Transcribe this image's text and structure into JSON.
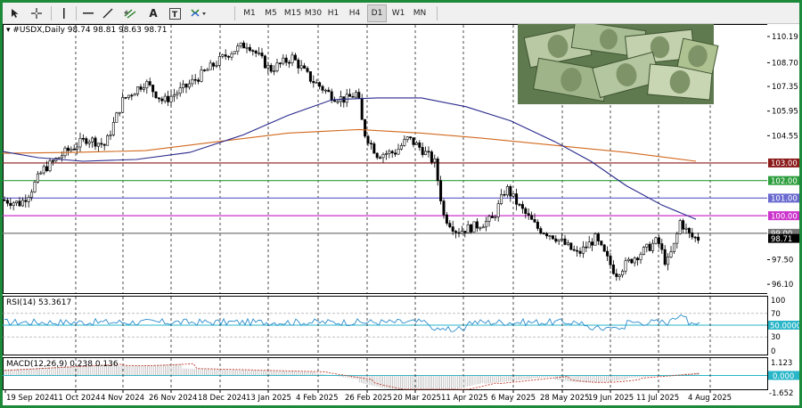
{
  "toolbar": {
    "timeframes": [
      "M1",
      "M5",
      "M15",
      "M30",
      "H1",
      "H4",
      "D1",
      "W1",
      "MN"
    ],
    "active_timeframe": "D1",
    "tools": [
      "cursor-icon",
      "crosshair-icon",
      "vertical-line-icon",
      "horizontal-line-icon",
      "trendline-icon",
      "channel-icon",
      "text-icon",
      "label-icon",
      "shapes-icon"
    ]
  },
  "chart": {
    "header": "#USDX,Daily  98.74 98.81 98.63 98.71",
    "price_scale": [
      "110.19",
      "108.70",
      "107.35",
      "105.95",
      "104.55",
      "103.00",
      "102.00",
      "101.00",
      "100.00",
      "99.00",
      "98.71",
      "97.50",
      "96.10"
    ],
    "hlines": [
      {
        "price": 103.0,
        "color": "#8b1a1a",
        "label": "103.00"
      },
      {
        "price": 102.0,
        "color": "#2e9e3e",
        "label": "102.00"
      },
      {
        "price": 101.0,
        "color": "#6a6ad0",
        "label": "101.00"
      },
      {
        "price": 100.0,
        "color": "#cc33cc",
        "label": "100.00"
      },
      {
        "price": 99.0,
        "color": "#777777",
        "label": "99.00"
      }
    ],
    "current_price": "98.71",
    "date_axis": [
      "19 Sep 2024",
      "11 Oct 2024",
      "4 Nov 2024",
      "26 Nov 2024",
      "18 Dec 2024",
      "13 Jan 2025",
      "4 Feb 2025",
      "26 Feb 2025",
      "20 Mar 2025",
      "11 Apr 2025",
      "6 May 2025",
      "28 May 2025",
      "19 Jun 2025",
      "11 Jul 2025",
      "4 Aug 2025"
    ],
    "ma_colors": {
      "fast": "#28288c",
      "slow": "#d2691e"
    },
    "image_alt": "money-image"
  },
  "rsi": {
    "header": "RSI(14) 53.3617",
    "scale": [
      "100",
      "70",
      "50.0000",
      "30",
      "0"
    ],
    "current": "50.0000"
  },
  "macd": {
    "header": "MACD(12,26,9) 0.238 0.136",
    "scale": [
      "1.123",
      "0.000",
      "-1.652"
    ],
    "current": "0.000"
  }
}
